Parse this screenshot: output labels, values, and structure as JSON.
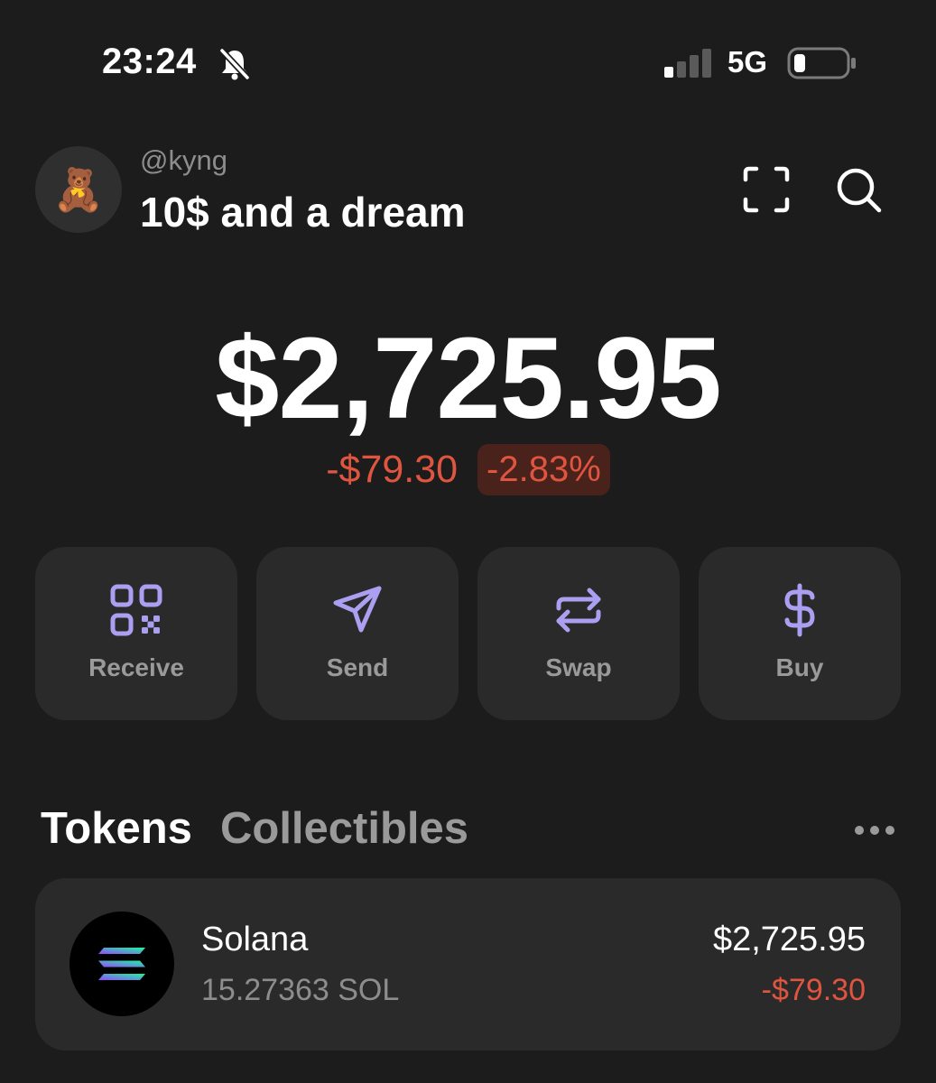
{
  "status_bar": {
    "time": "23:24",
    "network": "5G",
    "icons": [
      "bell-slash-icon",
      "signal-icon",
      "battery-icon"
    ]
  },
  "header": {
    "avatar_emoji": "🧸",
    "username": "@kyng",
    "account_name": "10$ and a dream",
    "icons": [
      "scan-icon",
      "search-icon"
    ]
  },
  "balance": {
    "total": "$2,725.95",
    "change_abs": "-$79.30",
    "change_pct": "-2.83%"
  },
  "actions": [
    {
      "label": "Receive",
      "icon": "qr-code-icon"
    },
    {
      "label": "Send",
      "icon": "send-icon"
    },
    {
      "label": "Swap",
      "icon": "swap-icon"
    },
    {
      "label": "Buy",
      "icon": "dollar-icon"
    }
  ],
  "tabs": {
    "tokens": "Tokens",
    "collectibles": "Collectibles",
    "active": "Tokens"
  },
  "tokens": [
    {
      "name": "Solana",
      "amount": "15.27363 SOL",
      "value": "$2,725.95",
      "change": "-$79.30",
      "icon": "solana-logo-icon"
    }
  ],
  "colors": {
    "background": "#1c1c1c",
    "card": "#2a2a2a",
    "accent": "#ab9ff2",
    "negative": "#e0553f"
  }
}
